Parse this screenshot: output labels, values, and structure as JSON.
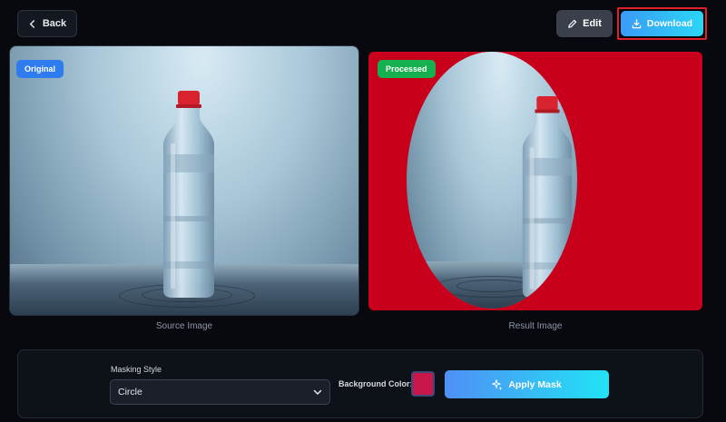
{
  "toolbar": {
    "back_label": "Back",
    "edit_label": "Edit",
    "download_label": "Download"
  },
  "original": {
    "badge": "Original",
    "caption": "Source Image"
  },
  "result": {
    "badge": "Processed",
    "caption": "Result Image"
  },
  "controls": {
    "masking_style_label": "Masking Style",
    "masking_style_value": "Circle",
    "background_color_label": "Background Color:",
    "background_color": "#c8174a",
    "apply_label": "Apply Mask"
  },
  "colors": {
    "accent_gradient_start": "#3b9bf7",
    "accent_gradient_end": "#2ad6f5",
    "processed_background": "#c8001b",
    "highlight_outline": "#e0202a"
  },
  "icons": {
    "back": "chevron-left-icon",
    "edit": "pencil-icon",
    "download": "download-icon",
    "select": "chevron-down-icon",
    "apply": "sparkle-icon"
  }
}
